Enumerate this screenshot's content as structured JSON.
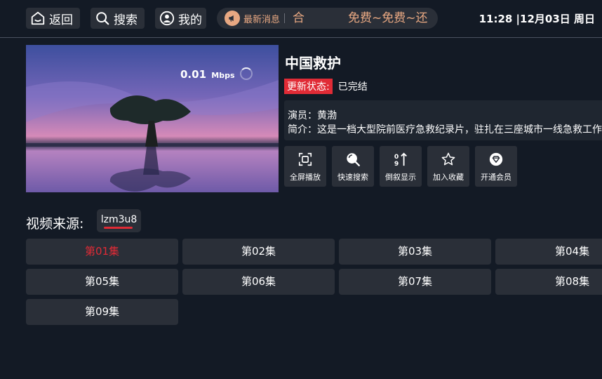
{
  "nav": {
    "back_label": "返回",
    "search_label": "搜索",
    "mine_label": "我的"
  },
  "news": {
    "label": "最新消息",
    "text_lead": "合",
    "text_main": "免费~免费~还"
  },
  "clock": "11:28 |12月03日 周日",
  "player": {
    "speed_value": "0.01",
    "speed_unit": "Mbps"
  },
  "show": {
    "title": "中国救护",
    "status_key": "更新状态:",
    "status_value": "已完结",
    "actor_line": "演员：黄渤",
    "intro_line": "简介：这是一档大型院前医疗急救纪录片，驻扎在三座城市一线急救工作"
  },
  "actions": [
    {
      "label": "全屏播放",
      "icon": "fullscreen-icon"
    },
    {
      "label": "快速搜索",
      "icon": "search-icon"
    },
    {
      "label": "倒叙显示",
      "icon": "sort-icon"
    },
    {
      "label": "加入收藏",
      "icon": "star-icon"
    },
    {
      "label": "开通会员",
      "icon": "vip-diamond-icon"
    }
  ],
  "sources": {
    "label": "视频来源:",
    "tabs": [
      "lzm3u8"
    ],
    "selected": "lzm3u8"
  },
  "episodes": [
    "第01集",
    "第02集",
    "第03集",
    "第04集",
    "第05集",
    "第06集",
    "第07集",
    "第08集",
    "第09集"
  ],
  "selected_episode": "第01集",
  "colors": {
    "background": "#131a25",
    "button_bg": "#2a2f38",
    "accent_red": "#e02b36",
    "news_orange": "#e8a882"
  }
}
